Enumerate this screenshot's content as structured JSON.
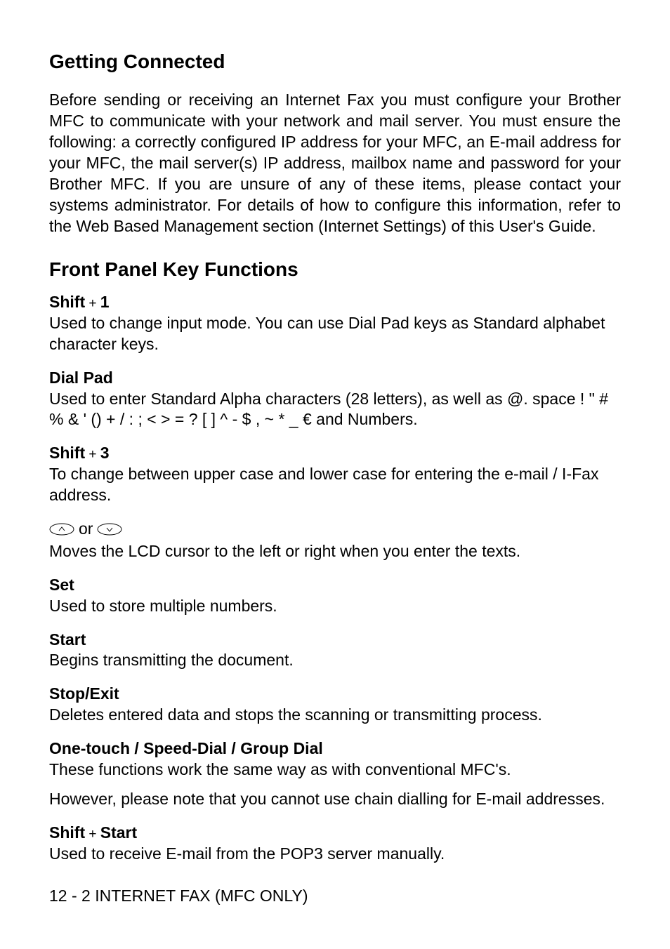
{
  "h1": "Getting Connected",
  "intro": "Before sending or receiving an Internet Fax you must configure your Brother MFC to communicate with your network and mail server. You must ensure the following: a correctly configured IP address for your MFC, an E-mail address for your MFC, the mail server(s) IP address, mailbox name and password for your Brother MFC. If you are unsure of any of these items, please contact your systems administrator. For details of how to configure this information, refer to the Web Based Management section (Internet Settings) of this User's Guide.",
  "h2": "Front Panel Key Functions",
  "keys": {
    "shift1": {
      "label_a": "Shift",
      "plus": " + ",
      "label_b": "1",
      "desc": "Used to change input mode. You can use Dial Pad keys as Standard alphabet character keys."
    },
    "dialpad": {
      "label": "Dial Pad",
      "desc_a": "Used to enter Standard Alpha characters (28 letters), as well as @. space ! \" # % & ' () + / : ; < > = ? [ ] ^ - $ , ~ * _ ",
      "desc_b": " and Numbers."
    },
    "shift3": {
      "label_a": "Shift",
      "plus": " + ",
      "label_b": "3",
      "desc": "To change between upper case and lower case for entering the e-mail / I-Fax address."
    },
    "arrows": {
      "or": "or",
      "desc": "Moves the LCD cursor to the left or right when you enter the texts."
    },
    "set": {
      "label": "Set",
      "desc": "Used to store multiple numbers."
    },
    "start": {
      "label": "Start",
      "desc": "Begins transmitting the document."
    },
    "stopexit": {
      "label": "Stop/Exit",
      "desc": "Deletes entered data and stops the scanning or transmitting process."
    },
    "onetouch": {
      "label": "One-touch / Speed-Dial / Group Dial",
      "desc1": "These functions work the same way as with conventional MFC's.",
      "desc2": "However, please note that you cannot use chain dialling for E-mail addresses."
    },
    "shiftstart": {
      "label_a": "Shift",
      "plus": " + ",
      "label_b": "Start",
      "desc": "Used to receive E-mail from the POP3 server manually."
    }
  },
  "footer": "12 - 2 INTERNET FAX (MFC ONLY)"
}
